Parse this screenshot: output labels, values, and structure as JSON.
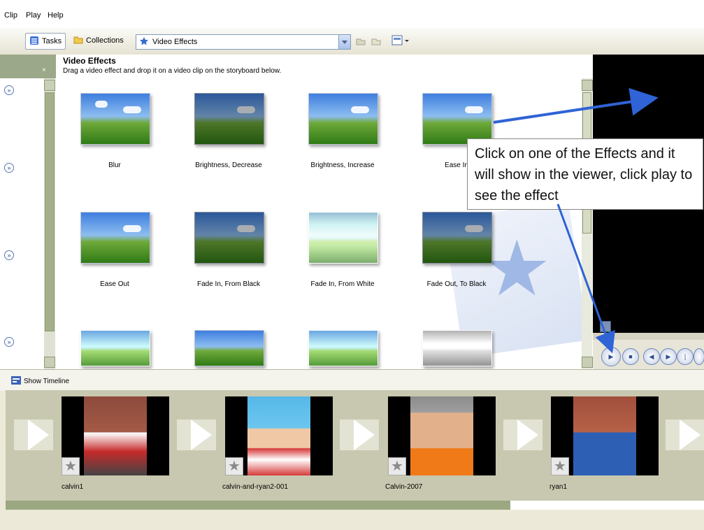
{
  "menu": [
    "Clip",
    "Play",
    "Help"
  ],
  "toolbar": {
    "tasks_label": "Tasks",
    "collections_label": "Collections",
    "combo_value": "Video Effects"
  },
  "effects": {
    "title": "Video Effects",
    "description": "Drag a video effect and drop it on a video clip on the storyboard below.",
    "items": [
      "Blur",
      "Brightness, Decrease",
      "Brightness, Increase",
      "Ease In",
      "Ease Out",
      "Fade In, From Black",
      "Fade In, From White",
      "Fade Out, To Black"
    ]
  },
  "callout": {
    "text": "Click on one of the Effects and it will show in the viewer, click play to see the effect"
  },
  "timeline": {
    "show_label": "Show Timeline"
  },
  "storyboard": {
    "clips": [
      "calvin1",
      "calvin-and-ryan2-001",
      "Calvin-2007",
      "ryan1"
    ]
  },
  "colors": {
    "task_strip_head": "#9ca88a",
    "storyboard_bg": "#c8c8b0",
    "callout_arrow": "#2f63d6",
    "viewer_screen": "#000000"
  },
  "icons": {
    "tasks": "tasks-icon",
    "collections": "folder-icon",
    "combo": "star-icon",
    "timeline": "timeline-icon",
    "clip_effect": "star-icon"
  }
}
